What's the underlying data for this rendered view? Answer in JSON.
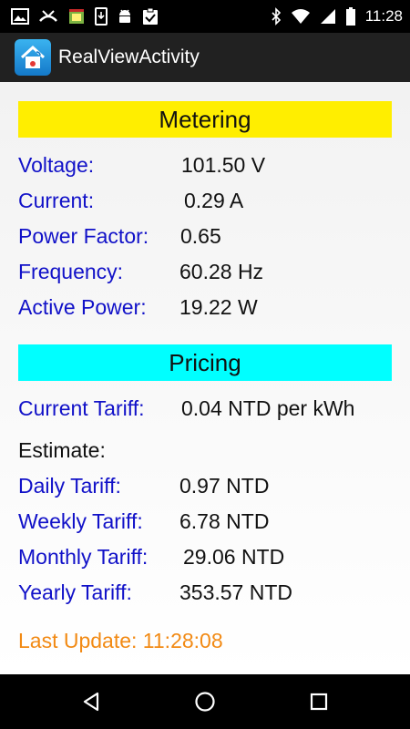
{
  "status_bar": {
    "time": "11:28",
    "left_icons": [
      "image-icon",
      "missed-call-icon",
      "store-icon",
      "phone-download-icon",
      "android-debug-icon",
      "clipboard-check-icon"
    ],
    "right_icons": [
      "bluetooth-icon",
      "wifi-icon",
      "signal-icon",
      "battery-icon"
    ]
  },
  "action_bar": {
    "title": "RealViewActivity"
  },
  "metering": {
    "header": "Metering",
    "rows": [
      {
        "label": "Voltage:",
        "value": "101.50 V"
      },
      {
        "label": "Current:",
        "value": "0.29 A"
      },
      {
        "label": "Power Factor:",
        "value": "0.65"
      },
      {
        "label": "Frequency:",
        "value": "60.28 Hz"
      },
      {
        "label": "Active Power:",
        "value": "19.22 W"
      }
    ]
  },
  "pricing": {
    "header": "Pricing",
    "current_tariff": {
      "label": "Current Tariff:",
      "value": "0.04 NTD per kWh"
    },
    "estimate_label": "Estimate:",
    "rows": [
      {
        "label": "Daily Tariff:",
        "value": "0.97 NTD"
      },
      {
        "label": "Weekly Tariff:",
        "value": "6.78 NTD"
      },
      {
        "label": "Monthly Tariff:",
        "value": "29.06 NTD"
      },
      {
        "label": "Yearly Tariff:",
        "value": "353.57 NTD"
      }
    ]
  },
  "last_update": "Last Update: 11:28:08",
  "colors": {
    "metering_header_bg": "#ffee00",
    "pricing_header_bg": "#00ffff",
    "label_blue": "#1111c8",
    "last_update_orange": "#f28a14"
  }
}
